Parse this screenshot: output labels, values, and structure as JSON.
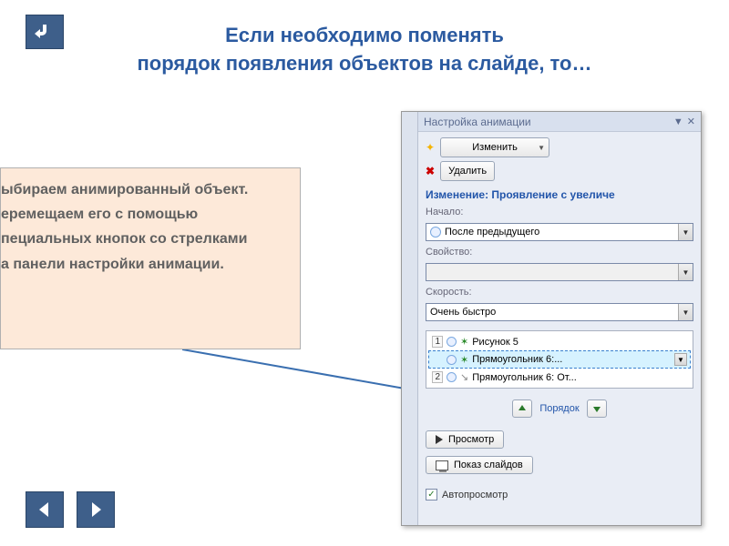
{
  "title": {
    "line1": "Если необходимо поменять",
    "line2": "порядок появления объектов на слайде, то…"
  },
  "textbox": {
    "line1": "ыбираем анимированный объект.",
    "line2": "еремещаем его с помощью",
    "line3": "пециальных кнопок со стрелками",
    "line4": "а панели настройки анимации."
  },
  "panel": {
    "header": "Настройка анимации",
    "modify_btn": "Изменить",
    "remove_btn": "Удалить",
    "change_lbl": "Изменение: Проявление с увеличе",
    "start_lbl": "Начало:",
    "start_value": "После предыдущего",
    "property_lbl": "Свойство:",
    "speed_lbl": "Скорость:",
    "speed_value": "Очень быстро",
    "items": [
      {
        "num": "1",
        "text": "Рисунок 5"
      },
      {
        "num": "",
        "text": "Прямоугольник 6:..."
      },
      {
        "num": "2",
        "text": "Прямоугольник 6: От..."
      }
    ],
    "order_lbl": "Порядок",
    "preview_btn": "Просмотр",
    "slideshow_btn": "Показ слайдов",
    "autopreview_lbl": "Автопросмотр"
  }
}
